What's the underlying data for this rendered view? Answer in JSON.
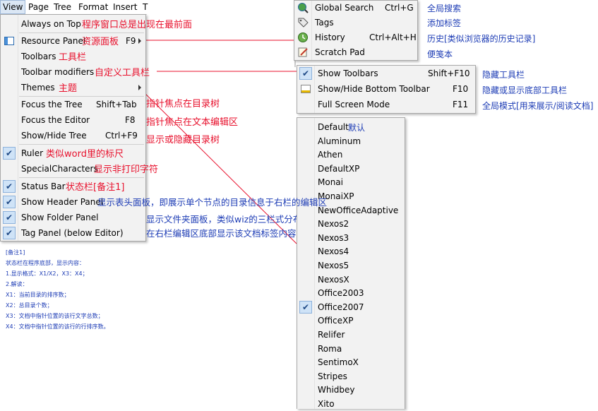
{
  "menubar": [
    "View",
    "Page",
    "Tree",
    "Format",
    "Insert",
    "T"
  ],
  "view_menu": {
    "items": [
      {
        "label": "Always on Top",
        "shortcut": "",
        "note": "程序窗口总是出现在最前面"
      },
      {
        "label": "Resource Panel",
        "shortcut": "F9",
        "note": "资源面板"
      },
      {
        "label": "Toolbars",
        "shortcut": "",
        "note": "工具栏"
      },
      {
        "label": "Toolbar modifiers",
        "shortcut": "",
        "note": "自定义工具栏"
      },
      {
        "label": "Themes",
        "shortcut": "",
        "note": "主题"
      },
      {
        "label": "Focus the Tree",
        "shortcut": "Shift+Tab",
        "note": "指针焦点在目录树"
      },
      {
        "label": "Focus the Editor",
        "shortcut": "F8",
        "note": "指针焦点在文本编辑区"
      },
      {
        "label": "Show/Hide Tree",
        "shortcut": "Ctrl+F9",
        "note": "显示或隐藏目录树"
      },
      {
        "label": "Ruler",
        "shortcut": "",
        "note": "类似word里的标尺"
      },
      {
        "label": "SpecialCharacters",
        "shortcut": "",
        "note": "显示非打印字符"
      },
      {
        "label": "Status Bar",
        "shortcut": "",
        "note": "状态栏[备注1]"
      },
      {
        "label": "Show Header Panel",
        "shortcut": "",
        "note": "显示表头面板，即展示单个节点的目录信息于右栏的编辑区"
      },
      {
        "label": "Show Folder Panel",
        "shortcut": "",
        "note": "显示文件夹面板，类似wiz的三栏式分布"
      },
      {
        "label": "Tag Panel (below Editor)",
        "shortcut": "",
        "note": "在右栏编辑区底部显示该文档标签内容"
      }
    ]
  },
  "resource_menu": {
    "items": [
      {
        "label": "Global Search",
        "shortcut": "Ctrl+G",
        "icon": "globe-search-icon",
        "note": "全局搜索"
      },
      {
        "label": "Tags",
        "shortcut": "",
        "icon": "tags-icon",
        "note": "添加标签"
      },
      {
        "label": "History",
        "shortcut": "Ctrl+Alt+H",
        "icon": "history-icon",
        "note": "历史[类似浏览器的历史记录]"
      },
      {
        "label": "Scratch Pad",
        "shortcut": "",
        "icon": "scratch-pad-icon",
        "note": "便笺本"
      }
    ]
  },
  "toolbar_menu": {
    "items": [
      {
        "label": "Show Toolbars",
        "shortcut": "Shift+F10",
        "note": "隐藏工具栏"
      },
      {
        "label": "Show/Hide Bottom Toolbar",
        "shortcut": "F10",
        "note": "隐藏或显示底部工具栏"
      },
      {
        "label": "Full Screen Mode",
        "shortcut": "F11",
        "note": "全局模式[用来展示/阅读文档]"
      }
    ]
  },
  "themes_menu": {
    "default_note": "默认",
    "items": [
      "Default",
      "Aluminum",
      "Athen",
      "DefaultXP",
      "Monai",
      "MonaiXP",
      "NewOfficeAdaptive",
      "Nexos2",
      "Nexos3",
      "Nexos4",
      "Nexos5",
      "NexosX",
      "Office2003",
      "Office2007",
      "OfficeXP",
      "Relifer",
      "Roma",
      "SentimoX",
      "Stripes",
      "Whidbey",
      "Xito"
    ]
  },
  "footnote": [
    "[备注1]",
    "状态栏在程序底部，显示内容：",
    "1.显示格式：X1/X2，X3：X4；",
    "2.解读：",
    "X1：当前目录的排序数；",
    "X2：总目录个数；",
    "X3：文档中指针位置的该行文字总数；",
    "X4：文档中指针位置的该行的行排序数。"
  ],
  "colors": {
    "annotation_red": "#e8112d",
    "annotation_blue": "#1d3cb5",
    "highlight": "#cde2f6"
  }
}
